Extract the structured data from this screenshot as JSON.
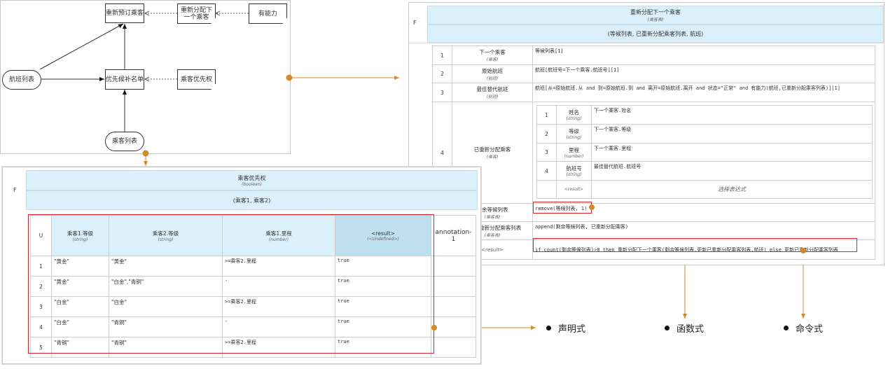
{
  "drg": {
    "nodes": {
      "rebook": "重新预订乘客",
      "reassign": "重新分配下一个乘客",
      "capable": "有能力",
      "flights": "航班列表",
      "waitlist": "优先候补名单",
      "priority": "乘客优先权",
      "passengers": "乘客列表"
    }
  },
  "reassign": {
    "f": "F",
    "title": "重新分配下一个乘客",
    "type": "(乘客表)",
    "params": "(等候列表, 已重新分配乘客列表, 航班)",
    "rows": [
      {
        "n": "1",
        "name": "下一个乘客",
        "type": "(乘客)",
        "expr": "等候列表[1]"
      },
      {
        "n": "2",
        "name": "原始航班",
        "type": "(航班)",
        "expr": "航班[航班号=下一个乘客.航班号][1]"
      },
      {
        "n": "3",
        "name": "最佳替代航班",
        "type": "(航班)",
        "expr": "航班[从=原始航班.从 and 到=原始航班.到 and 离开=原始航班.离开 and 状态=\"正常\" and 有能力(航班,已重新分配乘客列表)][1]"
      },
      {
        "n": "4",
        "name": "已重新分配乘客",
        "type": "(乘客)"
      },
      {
        "name": "剩余等候列表",
        "type": "(乘客表)",
        "expr": "remove(等候列表, 1)"
      },
      {
        "name": "更新已重新分配乘客列表",
        "type": "(乘客表)",
        "expr": "append(剩余等候列表, 已重新分配乘客)"
      }
    ],
    "result_label": "<result>",
    "result": "if count(剩余等候列表)>0 then 重新分配下一个乘客(剩余等候列表,更新已重新分配乘客列表,航班) else 更新已重新分配乘客列表",
    "nested": [
      {
        "n": "1",
        "name": "姓名",
        "type": "(string)",
        "expr": "下一个乘客.姓名"
      },
      {
        "n": "2",
        "name": "等级",
        "type": "(string)",
        "expr": "下一个乘客.等级"
      },
      {
        "n": "3",
        "name": "里程",
        "type": "(number)",
        "expr": "下一个乘客.里程"
      },
      {
        "n": "4",
        "name": "航班号",
        "type": "(string)",
        "expr": "最佳替代航班.航班号"
      }
    ],
    "nested_result_label": "<result>",
    "nested_result": "选择表达式"
  },
  "priority": {
    "f": "F",
    "title": "乘客优先权",
    "type": "(boolean)",
    "params": "(乘客1, 乘客2)",
    "hit": "U",
    "cols": [
      {
        "name": "乘客1.等级",
        "type": "(string)"
      },
      {
        "name": "乘客2.等级",
        "type": "(string)"
      },
      {
        "name": "乘客1.里程",
        "type": "(number)"
      },
      {
        "name": "<result>",
        "type": "(<Undefined>)"
      }
    ],
    "annotation": "annotation-1",
    "rows": [
      [
        "1",
        "\"黄金\"",
        "\"黄金\"",
        ">=乘客2.里程",
        "true"
      ],
      [
        "2",
        "\"黄金\"",
        "\"白金\",\"青铜\"",
        "-",
        "true"
      ],
      [
        "3",
        "\"白金\"",
        "\"白金\"",
        ">=乘客2.里程",
        "true"
      ],
      [
        "4",
        "\"白金\"",
        "\"青铜\"",
        "-",
        "true"
      ],
      [
        "5",
        "\"青铜\"",
        "\"青铜\"",
        ">=乘客2.里程",
        "true"
      ]
    ]
  },
  "legend": {
    "declarative": "声明式",
    "functional": "函数式",
    "imperative": "命令式"
  },
  "colors": {
    "connector": "#d08a2a",
    "highlight": "#e0202a",
    "header": "#dcf0fb"
  }
}
